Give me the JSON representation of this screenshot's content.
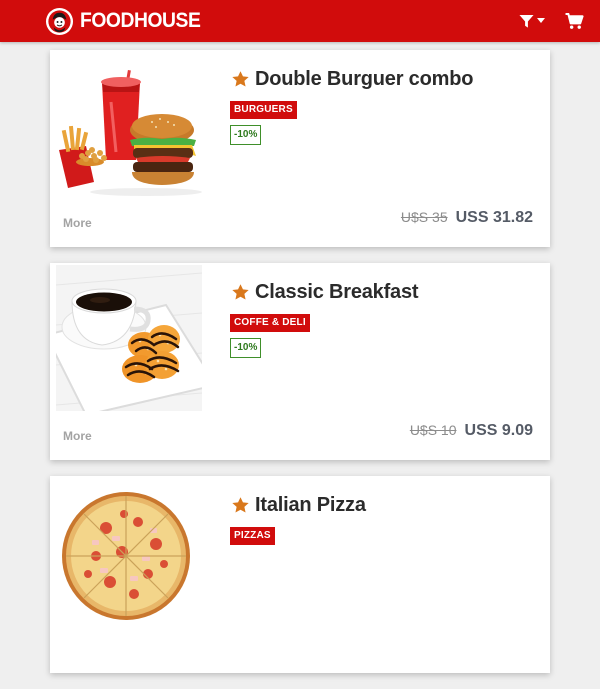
{
  "header": {
    "brand_name": "FOODHOUSE",
    "accent_color": "#d10c0c",
    "icons": [
      "logo-mascot-icon",
      "filter-icon",
      "shopping-cart-icon"
    ]
  },
  "products": [
    {
      "title": "Double Burguer combo",
      "category": "BURGUERS",
      "discount": "-10%",
      "more_label": "More",
      "old_price": "U$S 35",
      "new_price": "USS 31.82",
      "image": "burger-combo"
    },
    {
      "title": "Classic Breakfast",
      "category": "COFFE & DELI",
      "discount": "-10%",
      "more_label": "More",
      "old_price": "U$S 10",
      "new_price": "USS 9.09",
      "image": "coffee-breakfast"
    },
    {
      "title": "Italian Pizza",
      "category": "PIZZAS",
      "image": "pizza"
    }
  ],
  "colors": {
    "badge": "#d10c0c",
    "discount": "#2f7a1e",
    "star": "#d9781c"
  }
}
